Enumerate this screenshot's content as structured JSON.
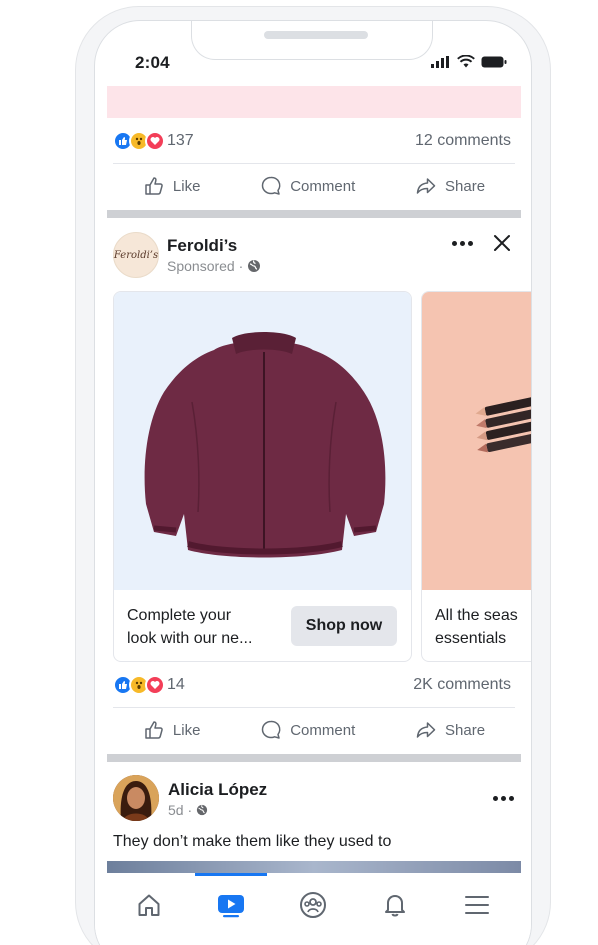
{
  "status_bar": {
    "time": "2:04"
  },
  "post1": {
    "reaction_count": "137",
    "comments": "12 comments"
  },
  "actions": {
    "like": "Like",
    "comment": "Comment",
    "share": "Share"
  },
  "sponsored_post": {
    "page_name": "Feroldi’s",
    "avatar_text": "Feroldi’s",
    "subtitle": "Sponsored ·",
    "cards": [
      {
        "text_line1": "Complete your",
        "text_line2": "look with our ne...",
        "button": "Shop now"
      },
      {
        "text_line1": "All the seas",
        "text_line2": "essentials"
      }
    ],
    "reaction_count": "14",
    "comments": "2K comments"
  },
  "post3": {
    "author": "Alicia López",
    "time": "5d ·",
    "caption": "They don’t make them like they used to"
  },
  "colors": {
    "accent": "#1877f2",
    "card1_bg": "#e9f1fb",
    "card2_bg": "#f5c4b1",
    "jacket": "#6e2a44"
  }
}
